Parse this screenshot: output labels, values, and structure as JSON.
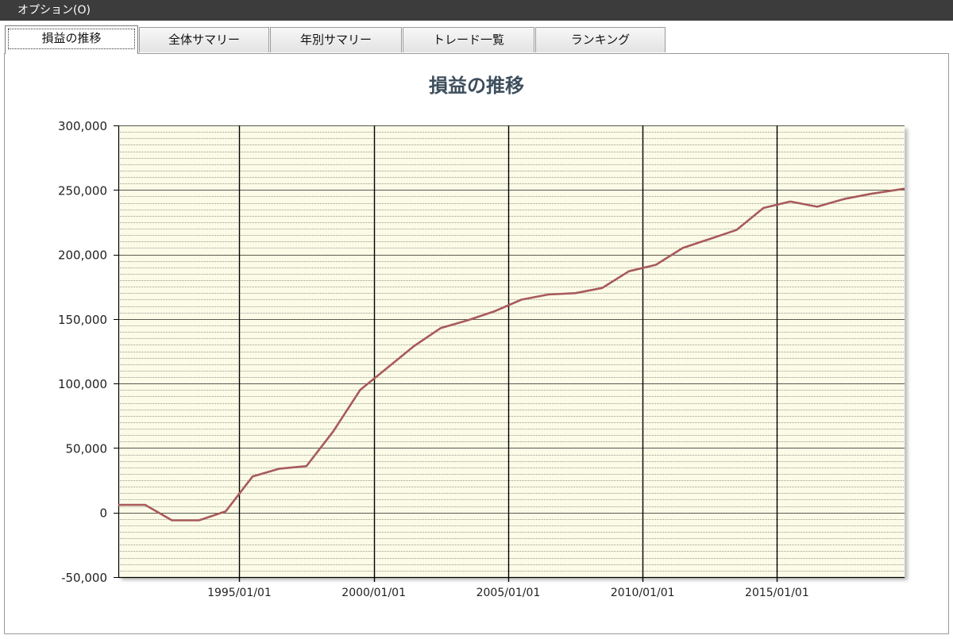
{
  "menu": {
    "options_label": "オプション(O)"
  },
  "tabs": [
    {
      "label": "損益の推移",
      "active": true
    },
    {
      "label": "全体サマリー",
      "active": false
    },
    {
      "label": "年別サマリー",
      "active": false
    },
    {
      "label": "トレード一覧",
      "active": false
    },
    {
      "label": "ランキング",
      "active": false
    }
  ],
  "colors": {
    "plot_background": "#fbfbe8",
    "line": "#a85a5a",
    "major_vertical_grid": "#000000",
    "horizontal_grid": "#9a9a8a"
  },
  "chart_data": {
    "type": "line",
    "title": "損益の推移",
    "xlabel": "",
    "ylabel": "",
    "xlim": [
      "1990-07-01",
      "2019-09-30"
    ],
    "ylim": [
      -50000,
      300000
    ],
    "y_major_step": 50000,
    "y_minor_step": 5000,
    "yticks": [
      "300,000",
      "250,000",
      "200,000",
      "150,000",
      "100,000",
      "50,000",
      "0",
      "-50,000"
    ],
    "yticks_values": [
      300000,
      250000,
      200000,
      150000,
      100000,
      50000,
      0,
      -50000
    ],
    "xticks": [
      "1995/01/01",
      "2000/01/01",
      "2005/01/01",
      "2010/01/01",
      "2015/01/01"
    ],
    "xticks_dates": [
      "1995-01-01",
      "2000-01-01",
      "2005-01-01",
      "2010-01-01",
      "2015-01-01"
    ],
    "grid": true,
    "legend": "none",
    "series": [
      {
        "dates": [
          "1990-07-01",
          "1991-06-30",
          "1992-06-30",
          "1993-06-30",
          "1994-06-30",
          "1995-06-30",
          "1996-06-30",
          "1997-06-30",
          "1998-06-30",
          "1999-06-30",
          "2000-06-30",
          "2001-06-30",
          "2002-06-30",
          "2003-06-30",
          "2004-06-30",
          "2005-06-30",
          "2006-06-30",
          "2007-06-30",
          "2008-06-30",
          "2009-06-30",
          "2010-06-30",
          "2011-06-30",
          "2012-06-30",
          "2013-06-30",
          "2014-06-30",
          "2015-06-30",
          "2016-06-30",
          "2017-06-30",
          "2018-06-30",
          "2019-09-30"
        ],
        "values": [
          6000,
          6000,
          -6000,
          -6000,
          1000,
          28000,
          34000,
          36000,
          63000,
          95000,
          112000,
          129000,
          143000,
          149000,
          156000,
          165000,
          169000,
          170000,
          174000,
          187000,
          192000,
          205000,
          212000,
          219000,
          236000,
          241000,
          237000,
          243000,
          247000,
          251000
        ]
      }
    ]
  }
}
